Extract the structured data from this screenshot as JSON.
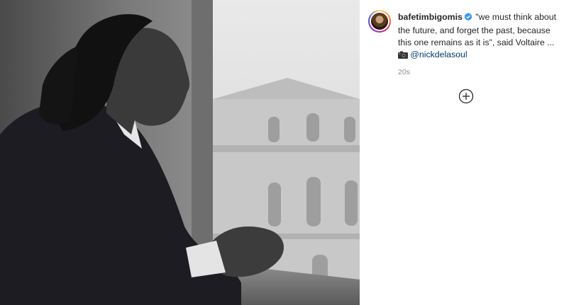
{
  "post": {
    "username": "bafetimbigomis",
    "caption": "\"we must think about the future, and forget the past, because this one remains as it is\", said Voltaire ...",
    "mention": "@nickdelasoul",
    "time": "20s"
  },
  "icons": {
    "verified": "verified-badge-icon",
    "camera": "camera-emoji-icon",
    "add": "plus-circle-icon"
  },
  "colors": {
    "username": "#262626",
    "mention": "#00376b",
    "timestamp": "#8e8e8e",
    "verified": "#3897f0"
  }
}
